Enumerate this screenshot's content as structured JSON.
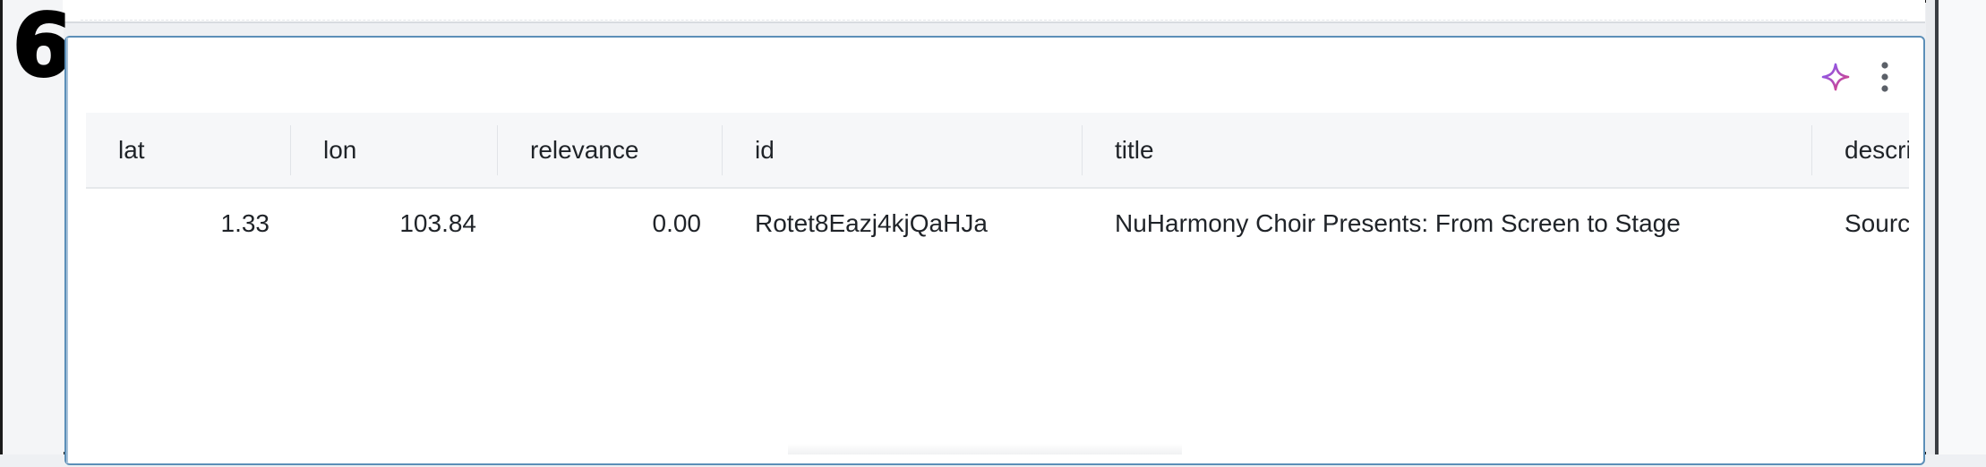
{
  "step_badge": "6",
  "toolbar": {
    "sparkle_icon": "sparkle-icon",
    "more_icon": "more-vertical-icon"
  },
  "table": {
    "columns": [
      "lat",
      "lon",
      "relevance",
      "id",
      "title",
      "description"
    ],
    "rows": [
      {
        "lat": "1.33",
        "lon": "103.84",
        "relevance": "0.00",
        "id": "Rotet8Eazj4kjQaHJa",
        "title": "NuHarmony Choir Presents: From Screen to Stage",
        "description": "Source"
      }
    ]
  },
  "colors": {
    "cell_border": "#5c8fb8",
    "header_bg": "#f6f7f9",
    "sparkle_gradient": [
      "#7b5cff",
      "#e0407a"
    ]
  }
}
